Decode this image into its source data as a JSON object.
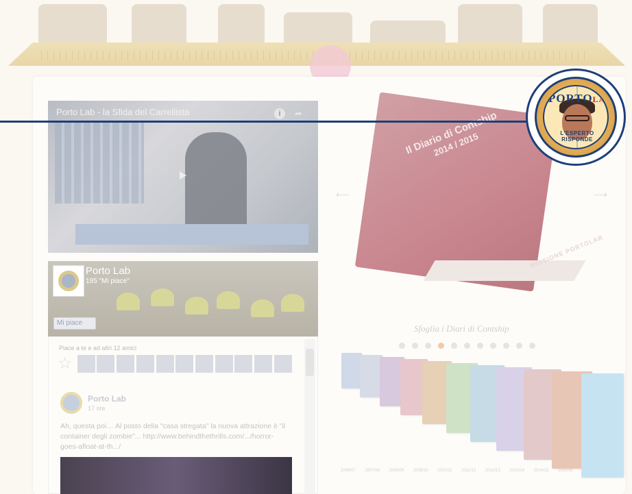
{
  "video": {
    "title": "Porto Lab - la Sfida del Carrellista"
  },
  "facebook": {
    "page_name": "Porto Lab",
    "likes_count": "195 \"Mi piace\"",
    "like_button": "Mi piace",
    "friends_text": "Piace a te e ad altri 12 amici",
    "post": {
      "author": "Porto Lab",
      "time": "17 ore",
      "text": "Ah, questa poi… Al posto della \"casa stregata\" la nuova attrazione è \"il container degli zombie\"... http://www.behindthethrills.com/.../horror-goes-afloat-at-th.../"
    }
  },
  "book": {
    "title": "Il Diario di Contship",
    "year": "2014 / 2015",
    "brand": "MISSIONE PORTOLAB"
  },
  "diari": {
    "title": "Sfoglia i Diari di Contship",
    "years": [
      "2006/07",
      "2007/08",
      "2008/09",
      "2009/10",
      "2010/11",
      "2011/12",
      "2012/13",
      "2013/14",
      "2014/15",
      "2015/16",
      "2016/17"
    ],
    "active_index": 3
  },
  "badge": {
    "top_text": "PORTO",
    "top_accent": "LAB",
    "bottom_text": "L'ESPERTO RISPONDE"
  },
  "colors": {
    "accent_blue": "#1d3f77",
    "accent_red": "#c0202a"
  }
}
